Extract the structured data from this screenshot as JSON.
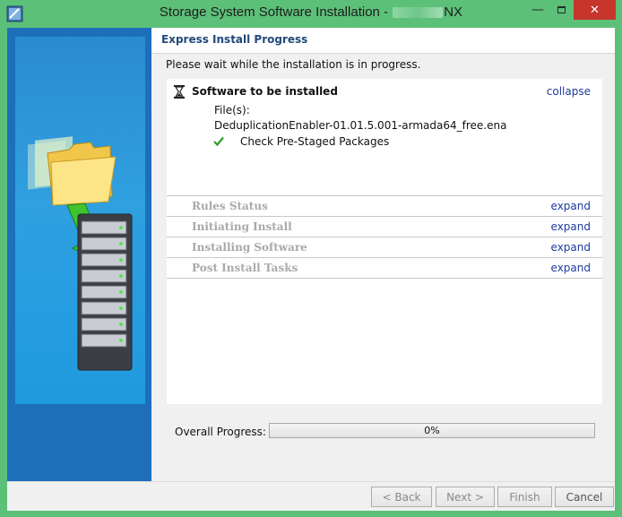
{
  "window": {
    "title_prefix": "Storage System Software Installation - ",
    "title_suffix": "NX"
  },
  "header": {
    "title": "Express Install Progress"
  },
  "main": {
    "wait_message": "Please wait while the installation is in progress."
  },
  "active_step": {
    "title": "Software to be installed",
    "toggle_label": "collapse",
    "files_label": "File(s):",
    "file_name": "DeduplicationEnabler-01.01.5.001-armada64_free.ena",
    "check_item": "Check Pre-Staged Packages"
  },
  "steps": [
    {
      "title": "Rules Status",
      "toggle_label": "expand"
    },
    {
      "title": "Initiating Install",
      "toggle_label": "expand"
    },
    {
      "title": "Installing Software",
      "toggle_label": "expand"
    },
    {
      "title": "Post Install Tasks",
      "toggle_label": "expand"
    }
  ],
  "progress": {
    "label": "Overall Progress:",
    "percent_text": "0%",
    "value": 0
  },
  "footer": {
    "back_label": "< Back",
    "next_label": "Next >",
    "finish_label": "Finish",
    "cancel_label": "Cancel"
  },
  "colors": {
    "window_frame": "#5dc079",
    "close_button": "#c7352c",
    "sidebar": "#1d6fba",
    "header_title": "#21497a",
    "link": "#1e3a9e",
    "check": "#2a9a2a",
    "progress_fill": "#06b025"
  },
  "icons": {
    "app": "installer-app-icon",
    "status": "hourglass-icon",
    "check": "checkmark-icon",
    "sidebar": "folder-to-server-illustration"
  }
}
